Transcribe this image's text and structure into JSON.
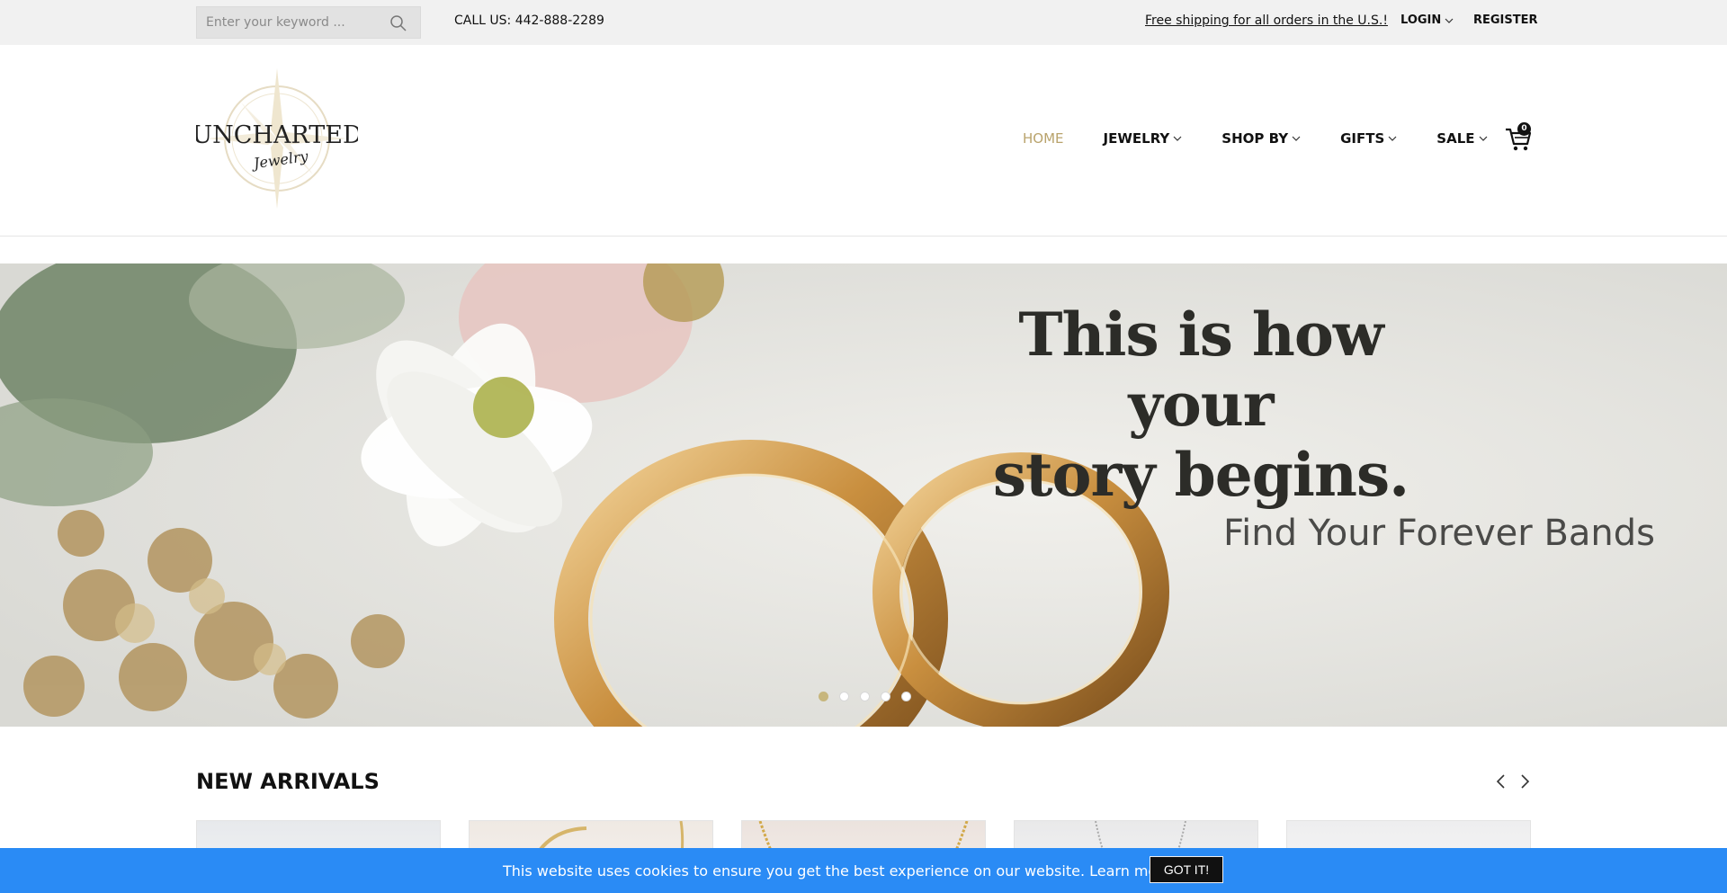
{
  "topbar": {
    "search_placeholder": "Enter your keyword ...",
    "call": "CALL US: 442-888-2289",
    "shipping": "Free shipping for all orders in the U.S.!",
    "login": "LOGIN",
    "register": "REGISTER"
  },
  "header": {
    "logo_text": "UNCHARTED",
    "logo_script": "Jewelry",
    "nav": [
      {
        "label": "HOME"
      },
      {
        "label": "JEWELRY"
      },
      {
        "label": "SHOP BY"
      },
      {
        "label": "GIFTS"
      },
      {
        "label": "SALE"
      }
    ],
    "cart_count": "0"
  },
  "hero": {
    "title_line1": "This is how your",
    "title_line2": "story begins.",
    "subtitle": "Find Your Forever Bands",
    "slides": 5,
    "active_slide": 1
  },
  "arrivals": {
    "title": "NEW ARRIVALS"
  },
  "cookie": {
    "text": "This website uses cookies to ensure you get the best experience on our website. Learn more",
    "button": "GOT IT!"
  },
  "colors": {
    "accent": "#b9a36c",
    "cookie_bar": "#2a8bf5",
    "topbar_bg": "#f1f1f1"
  }
}
